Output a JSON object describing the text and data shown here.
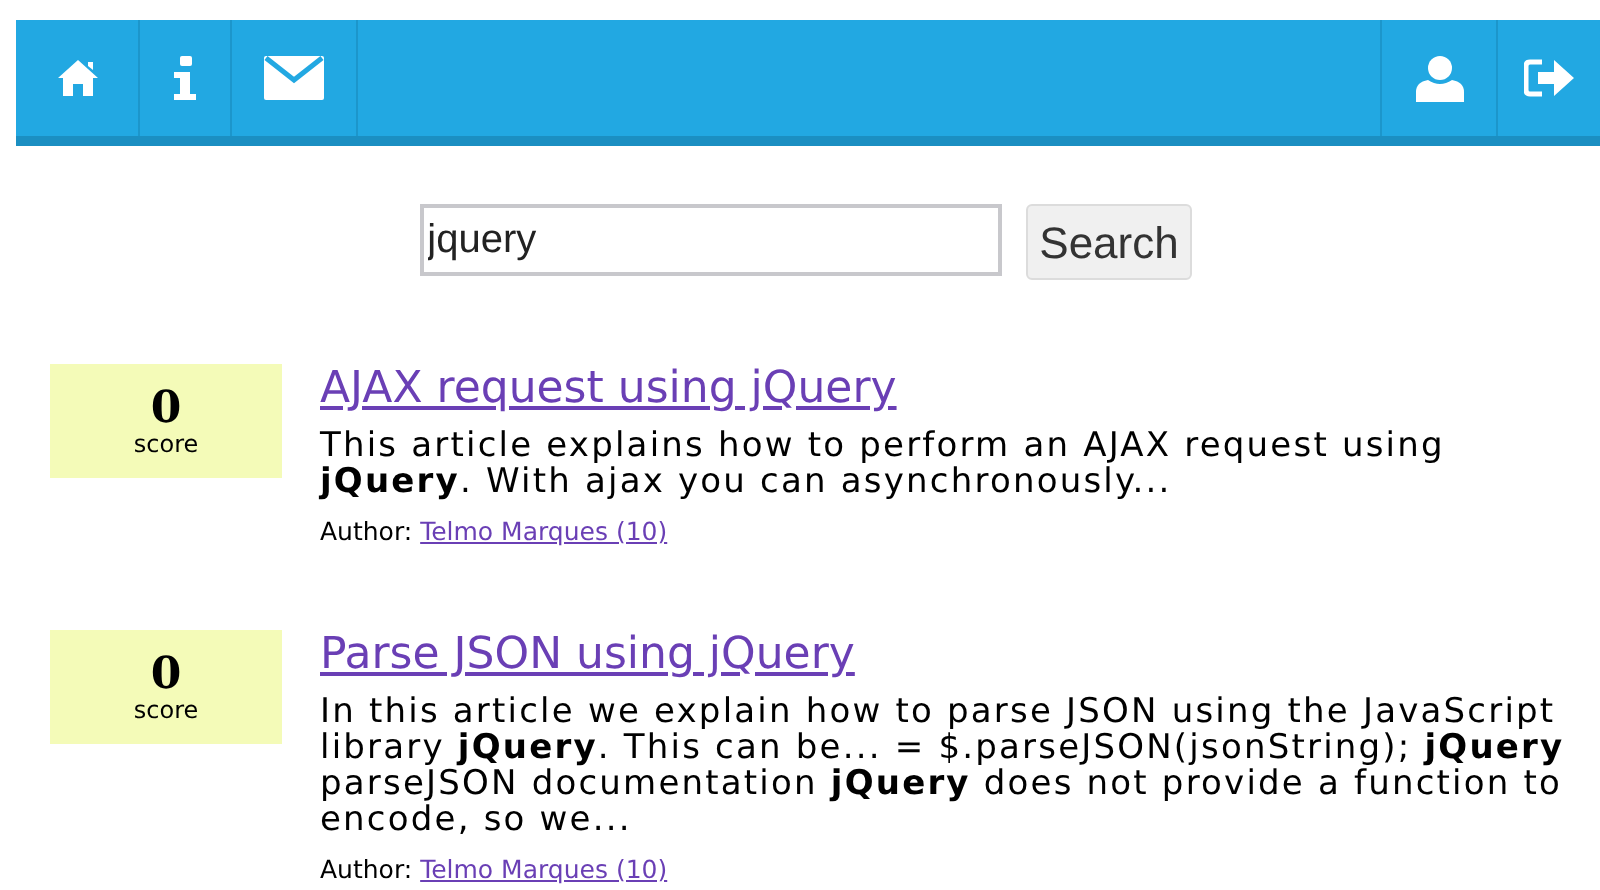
{
  "navbar": {
    "left_items": [
      {
        "kind": "home"
      },
      {
        "kind": "info"
      },
      {
        "kind": "mail"
      }
    ],
    "right_items": [
      {
        "kind": "user"
      },
      {
        "kind": "logout"
      }
    ]
  },
  "search": {
    "value": "jquery",
    "button": "Search"
  },
  "results": [
    {
      "score": "0",
      "score_label": "score",
      "title": "AJAX request using jQuery",
      "excerpt": "This article explains how to perform an AJAX request using **jQuery**. With ajax you can asynchronously...",
      "author_label": "Author:",
      "author": "Telmo Marques (10)"
    },
    {
      "score": "0",
      "score_label": "score",
      "title": "Parse JSON using jQuery",
      "excerpt": "In this article we explain how to parse JSON using the JavaScript library **jQuery**. This can be... = $.parseJSON(jsonString); **jQuery** parseJSON documentation **jQuery** does not provide a function to encode, so we...",
      "author_label": "Author:",
      "author": "Telmo Marques (10)"
    }
  ]
}
